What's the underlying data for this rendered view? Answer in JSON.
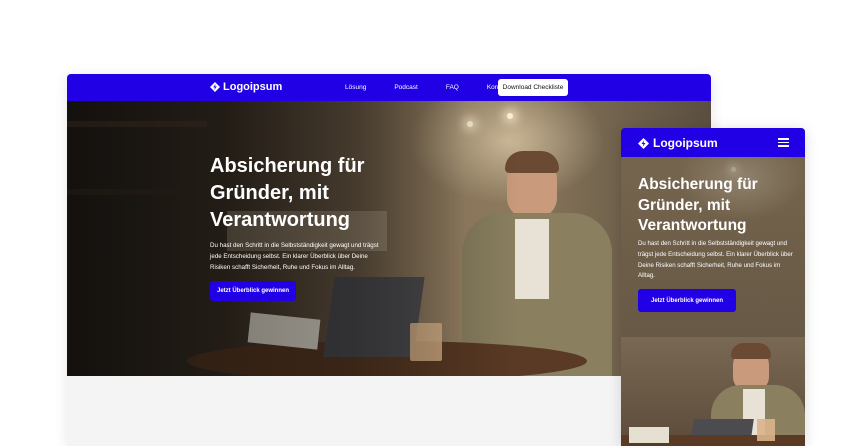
{
  "brand": {
    "name": "Logoipsum",
    "primary_color": "#2200e6",
    "logo_icon": "logoipsum-mark-icon"
  },
  "desktop": {
    "nav": {
      "links": [
        "Lösung",
        "Podcast",
        "FAQ",
        "Kontakt"
      ],
      "cta": "Download Checkliste"
    },
    "hero": {
      "title": "Absicherung für Gründer, mit Verantwortung",
      "text": "Du hast den Schritt in die Selbstständigkeit gewagt und trägst jede Entscheidung selbst. Ein klarer Überblick über Deine Risiken schafft Sicherheit, Ruhe und Fokus im Alltag.",
      "button": "Jetzt Überblick gewinnen"
    }
  },
  "mobile": {
    "menu_icon": "hamburger-menu-icon",
    "hero": {
      "title": "Absicherung für Gründer, mit Verantwortung",
      "text": "Du hast den Schritt in die Selbstständigkeit gewagt und trägst jede Entscheidung selbst. Ein klarer Überblick über Deine Risiken schafft Sicherheit, Ruhe und Fokus im Alltag.",
      "button": "Jetzt Überblick gewinnen"
    }
  }
}
